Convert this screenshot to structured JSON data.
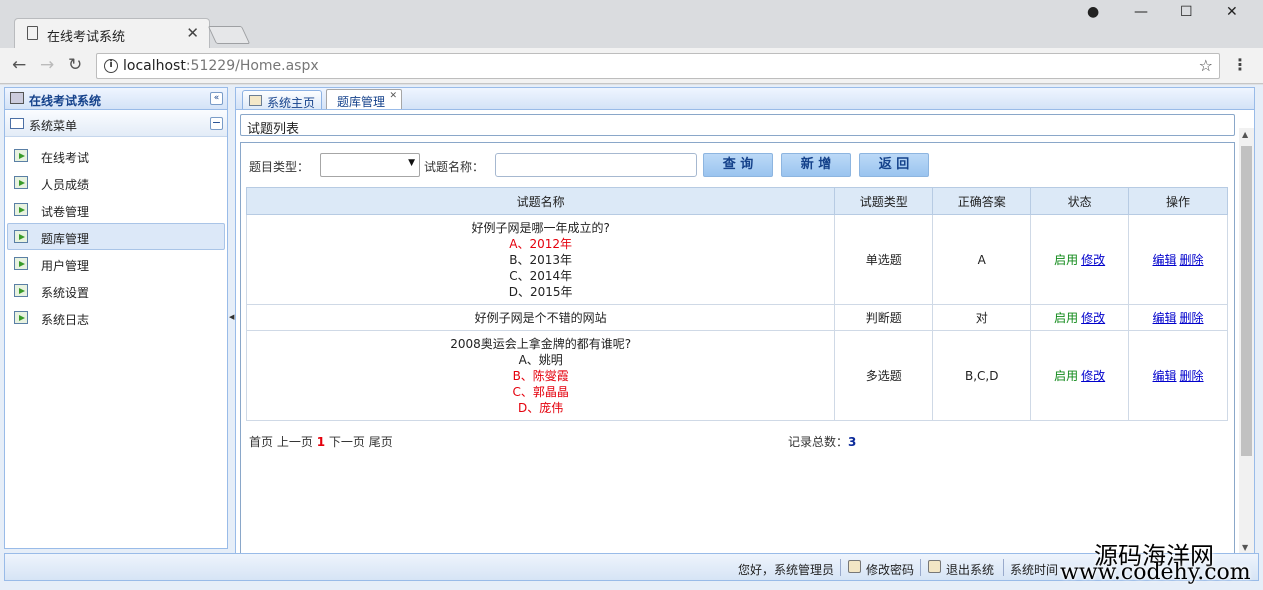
{
  "browser": {
    "tab_title": "在线考试系统",
    "url_host": "localhost",
    "url_path": ":51229/Home.aspx",
    "info_icon": "i"
  },
  "app": {
    "west_title": "在线考试系统",
    "accordion_title": "系统菜单",
    "menu": [
      {
        "label": "在线考试"
      },
      {
        "label": "人员成绩"
      },
      {
        "label": "试卷管理"
      },
      {
        "label": "题库管理"
      },
      {
        "label": "用户管理"
      },
      {
        "label": "系统设置"
      },
      {
        "label": "系统日志"
      }
    ],
    "active_menu_index": 3,
    "tabs": [
      {
        "label": "系统主页",
        "closable": false
      },
      {
        "label": "题库管理",
        "closable": true
      }
    ]
  },
  "panel": {
    "title": "试题列表",
    "search": {
      "type_label": "题目类型：",
      "type_value": "",
      "name_label": "试题名称：",
      "name_value": "",
      "btn_search": "查 询",
      "btn_add": "新 增",
      "btn_back": "返 回"
    },
    "table": {
      "headers": [
        "试题名称",
        "试题类型",
        "正确答案",
        "状态",
        "操作"
      ],
      "rows": [
        {
          "question": "好例子网是哪一年成立的?",
          "options": [
            {
              "text": "A、2012年",
              "correct": true
            },
            {
              "text": "B、2013年",
              "correct": false
            },
            {
              "text": "C、2014年",
              "correct": false
            },
            {
              "text": "D、2015年",
              "correct": false
            }
          ],
          "type": "单选题",
          "answer": "A",
          "status": "启用",
          "status_action": "修改",
          "edit": "编辑",
          "delete": "删除"
        },
        {
          "question": "好例子网是个不错的网站",
          "options": [],
          "type": "判断题",
          "answer": "对",
          "status": "启用",
          "status_action": "修改",
          "edit": "编辑",
          "delete": "删除"
        },
        {
          "question": "2008奥运会上拿金牌的都有谁呢?",
          "options": [
            {
              "text": "A、姚明",
              "correct": false
            },
            {
              "text": "B、陈燮霞",
              "correct": true
            },
            {
              "text": "C、郭晶晶",
              "correct": true
            },
            {
              "text": "D、庞伟",
              "correct": true
            }
          ],
          "type": "多选题",
          "answer": "B,C,D",
          "status": "启用",
          "status_action": "修改",
          "edit": "编辑",
          "delete": "删除"
        }
      ]
    },
    "pager": {
      "first": "首页",
      "prev": "上一页",
      "current": "1",
      "next": "下一页",
      "last": "尾页",
      "total_label": "记录总数：",
      "total": "3"
    }
  },
  "status_bar": {
    "greeting": "您好，系统管理员",
    "change_password": "修改密码",
    "logout": "退出系统",
    "time_label": "系统时间"
  },
  "watermark": {
    "line1": "源码海洋网",
    "line2": "www.codehy.com"
  },
  "colors": {
    "accent": "#15428b",
    "correct_option": "#e4000c",
    "status_enabled": "#118a1a",
    "link": "#0000cc"
  }
}
